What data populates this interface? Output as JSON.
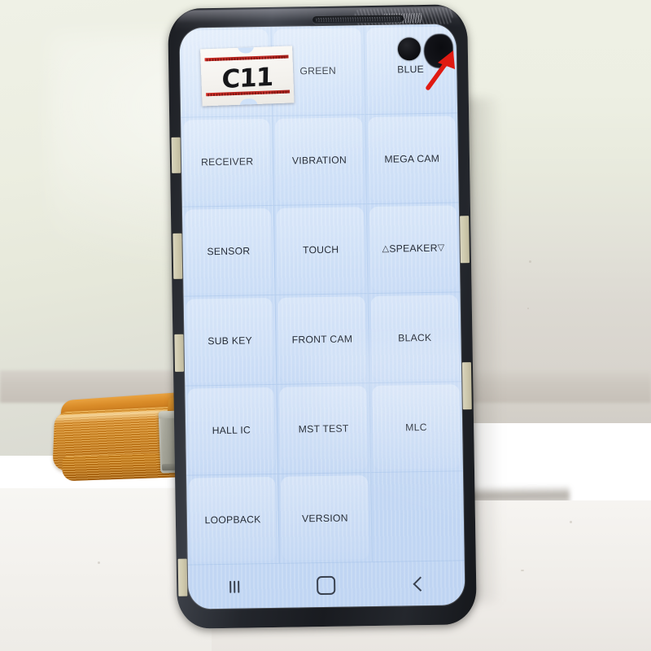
{
  "scene": {
    "subject": "smartphone-display-assembly",
    "device_label": "C11",
    "background_color": "#e9eadf",
    "surface_color": "#f4f2ee"
  },
  "phone": {
    "frame_color": "#22252b",
    "screen_color": "#cbdef7",
    "camera": {
      "name": "punch-hole-camera"
    },
    "defect": {
      "name": "screen-dark-spot"
    }
  },
  "sticker": {
    "code": "C11",
    "rule_color": "#c22b24"
  },
  "annotation": {
    "arrow_color": "#e01a12",
    "points_at": "screen-dark-spot"
  },
  "screen": {
    "app": "service-diagnostic-menu",
    "grid": {
      "columns": 3,
      "rows": 6,
      "cells": [
        {
          "label": "",
          "covered_by_sticker": true
        },
        {
          "label": "GREEN"
        },
        {
          "label": "BLUE"
        },
        {
          "label": "RECEIVER"
        },
        {
          "label": "VIBRATION"
        },
        {
          "label": "MEGA CAM"
        },
        {
          "label": "SENSOR"
        },
        {
          "label": "TOUCH"
        },
        {
          "label": "SPEAKER",
          "prefix": "△",
          "suffix": "▽"
        },
        {
          "label": "SUB KEY"
        },
        {
          "label": "FRONT CAM"
        },
        {
          "label": "BLACK"
        },
        {
          "label": "HALL IC"
        },
        {
          "label": "MST TEST"
        },
        {
          "label": "MLC"
        },
        {
          "label": "LOOPBACK"
        },
        {
          "label": "VERSION"
        },
        {
          "label": "",
          "empty": true
        }
      ]
    },
    "navbar": {
      "recents": "recents-icon",
      "home": "home-icon",
      "back": "back-icon"
    }
  },
  "cable": {
    "name": "flex-ribbon-cable",
    "color": "#d0871f",
    "connector_color": "#a3a398"
  }
}
